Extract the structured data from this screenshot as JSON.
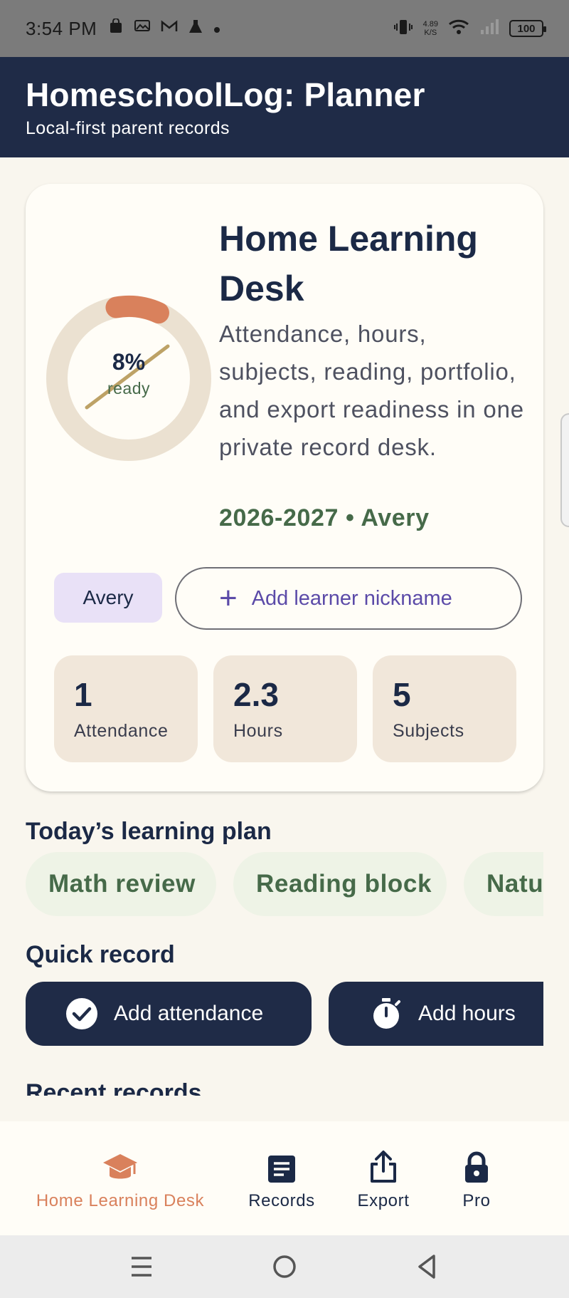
{
  "status_bar": {
    "time": "3:54 PM",
    "net_speed_value": "4.89",
    "net_speed_unit": "K/S",
    "battery": "100"
  },
  "app_bar": {
    "title": "HomeschoolLog: Planner",
    "subtitle": "Local-first parent records"
  },
  "hero": {
    "progress_percent": 8,
    "progress_label": "8%",
    "progress_caption": "ready",
    "title": "Home Learning Desk",
    "description": "Attendance, hours, subjects, reading, portfolio, and export readiness in one private record desk.",
    "meta": "2026-2027 • Avery",
    "learner_chip": "Avery",
    "add_nickname_label": "Add learner nickname",
    "stats": [
      {
        "value": "1",
        "label": "Attendance"
      },
      {
        "value": "2.3",
        "label": "Hours"
      },
      {
        "value": "5",
        "label": "Subjects"
      }
    ]
  },
  "plan": {
    "title": "Today’s learning plan",
    "items": [
      "Math review",
      "Reading block",
      "Natu"
    ]
  },
  "quick_record": {
    "title": "Quick record",
    "add_attendance": "Add attendance",
    "add_hours": "Add hours"
  },
  "recent": {
    "title": "Recent records"
  },
  "bottom_nav": [
    {
      "label": "Home Learning Desk",
      "icon": "graduation-cap-icon",
      "active": true
    },
    {
      "label": "Records",
      "icon": "document-icon",
      "active": false
    },
    {
      "label": "Export",
      "icon": "share-icon",
      "active": false
    },
    {
      "label": "Pro",
      "icon": "lock-icon",
      "active": false
    }
  ],
  "colors": {
    "primary": "#1f2b47",
    "accent": "#d9815c",
    "green": "#466a49",
    "purple": "#5b4aa8"
  }
}
